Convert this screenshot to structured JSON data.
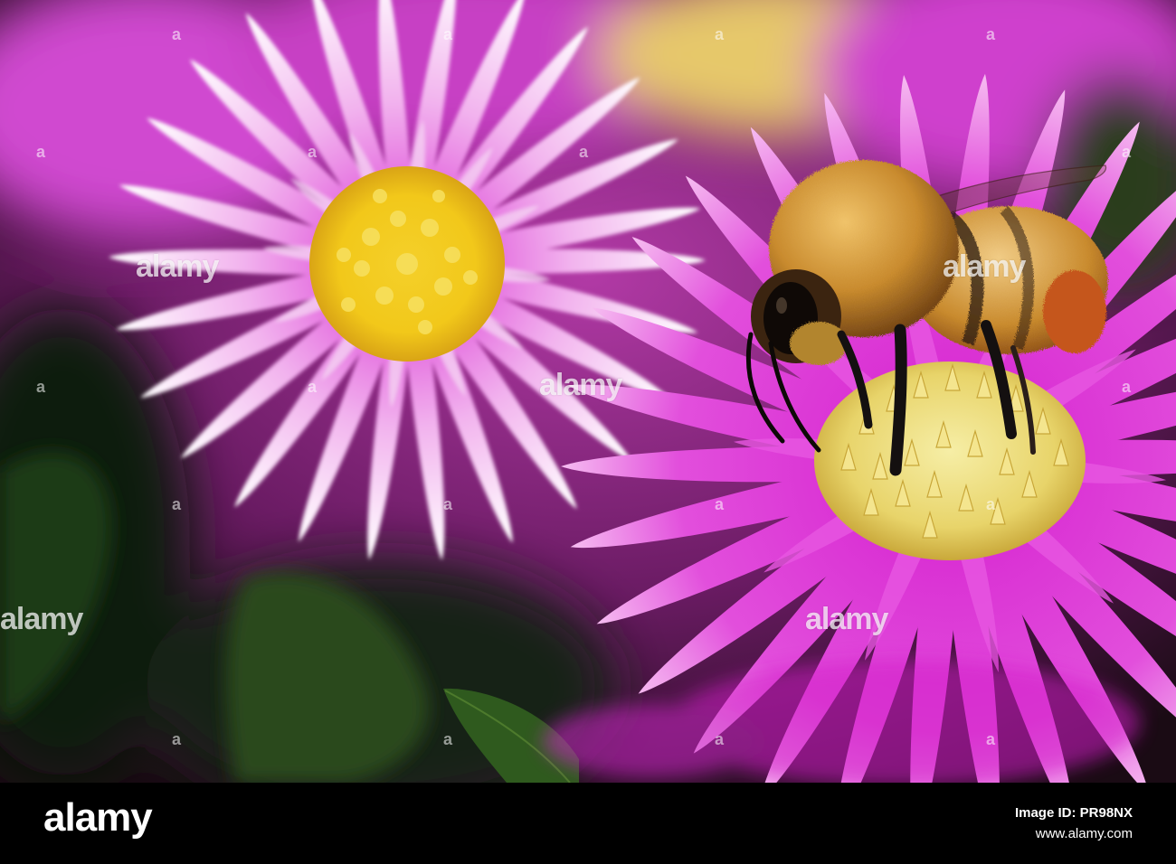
{
  "photo": {
    "subject": "bumblebee-on-aster",
    "colors": {
      "petal_magenta": "#d21fc8",
      "petal_light": "#f3a6ee",
      "center_yellow": "#f6d21b",
      "center_pale": "#f1e79a",
      "bee_orange": "#c88a2c",
      "leaf_green": "#2f5a1e"
    }
  },
  "watermark": {
    "text": "alamy"
  },
  "footer": {
    "logo": "alamy",
    "image_id_label": "Image ID: PR98NX",
    "site": "www.alamy.com"
  }
}
